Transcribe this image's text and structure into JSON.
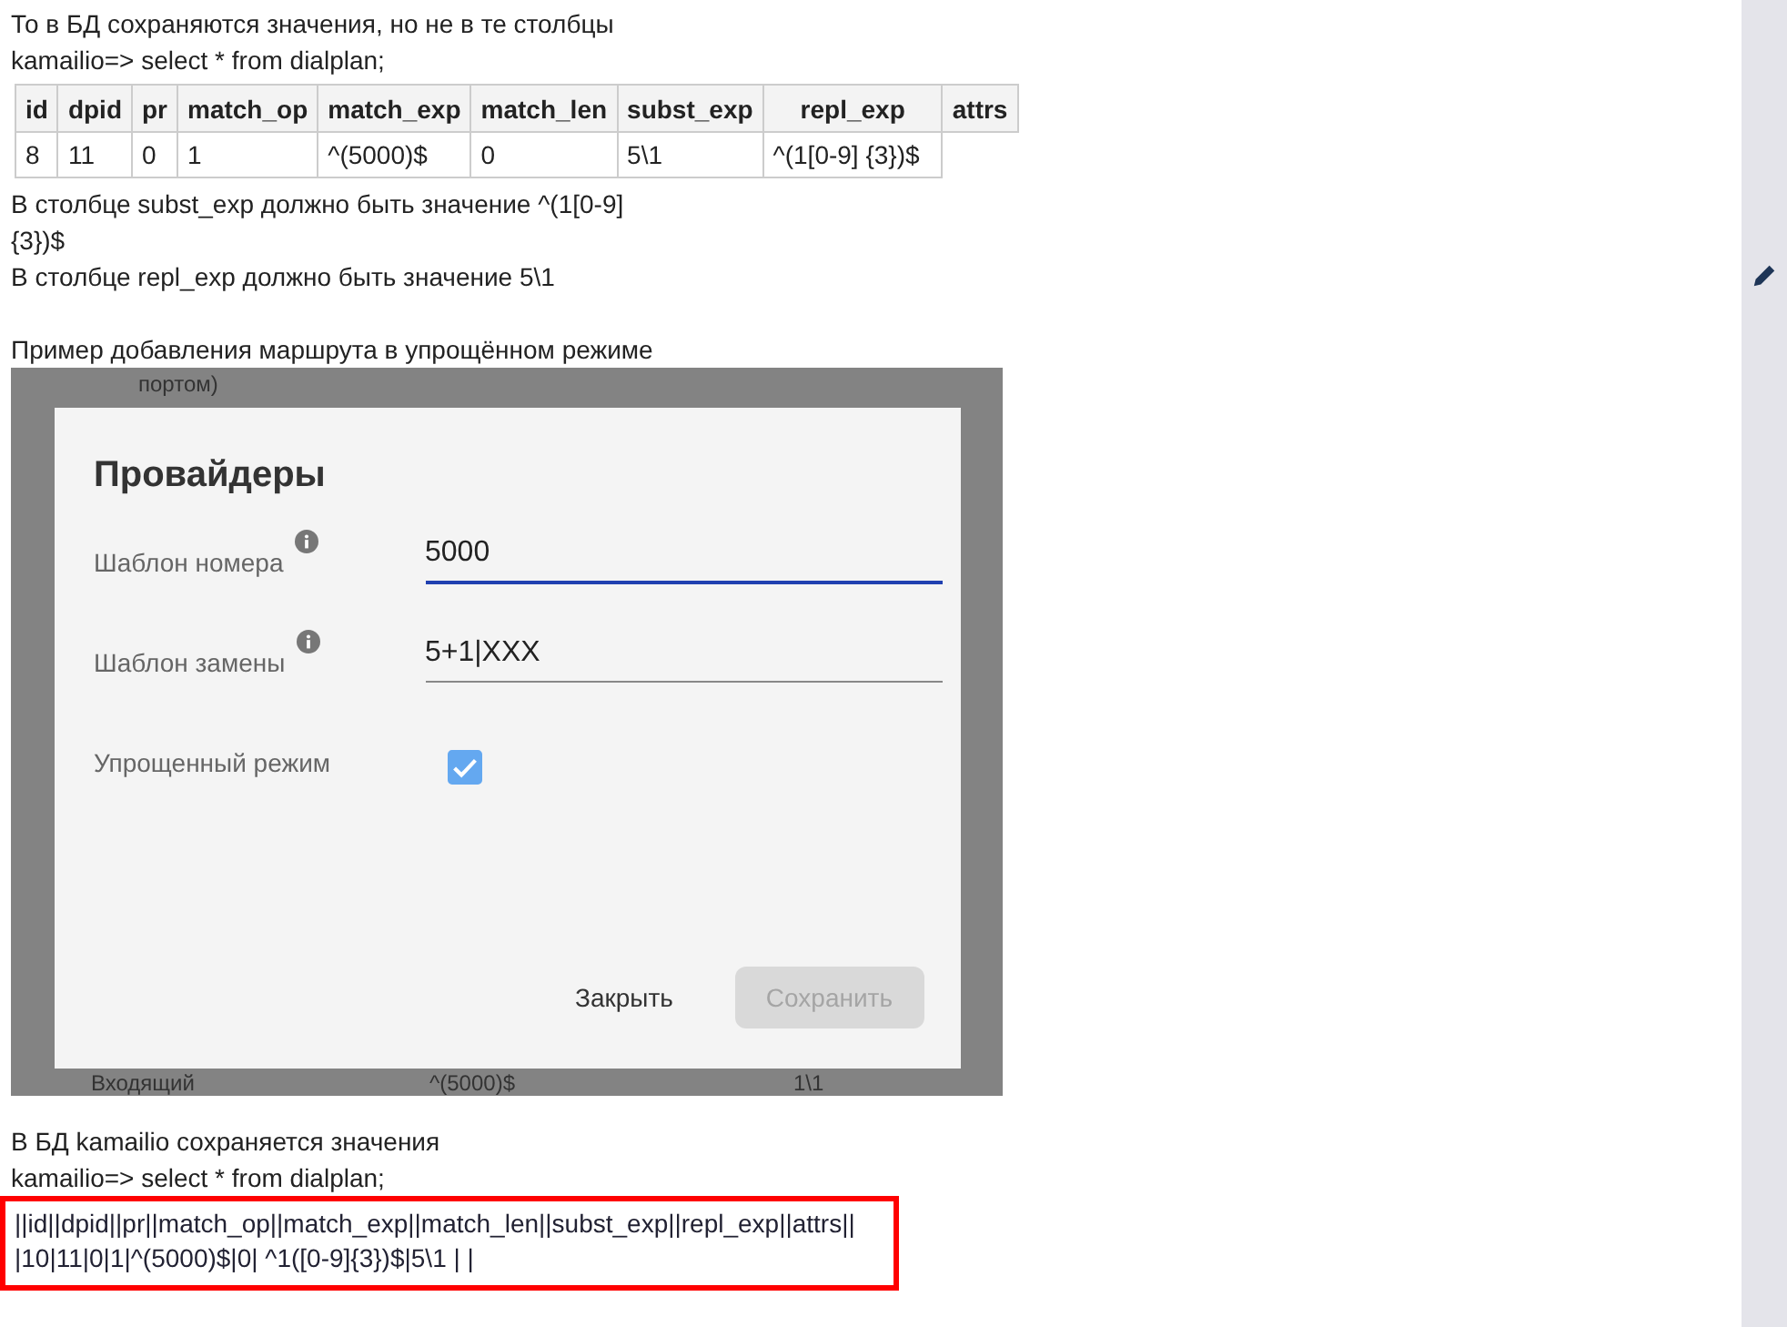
{
  "intro_lines": [
    "То в БД сохраняются значения, но не в те столбцы",
    "kamailio=> select * from dialplan;"
  ],
  "table": {
    "columns": [
      "id",
      "dpid",
      "pr",
      "match_op",
      "match_exp",
      "match_len",
      "subst_exp",
      "repl_exp",
      "attrs"
    ],
    "rows": [
      {
        "cells": [
          "8",
          "11",
          "0",
          "1",
          "^(5000)$",
          "0",
          "5\\1",
          "^(1[0-9] {3})$"
        ]
      }
    ]
  },
  "notes": [
    "В столбце subst_exp должно быть значение ^(1[0-9]",
    "{3})$",
    "В столбце repl_exp должно быть значение 5\\1"
  ],
  "example_caption": "Пример добавления маршрута в упрощённом режиме",
  "screenshot": {
    "background_texts": [
      "портом)"
    ],
    "background_row": [
      "Входящий",
      "^(5000)$",
      "1\\1"
    ],
    "dialog": {
      "title": "Провайдеры",
      "fields": [
        {
          "kind": "text",
          "label": "Шаблон номера",
          "value": "5000",
          "focused": true,
          "info": true
        },
        {
          "kind": "text",
          "label": "Шаблон замены",
          "value": "5+1|XXX",
          "focused": false,
          "info": true
        },
        {
          "kind": "checkbox",
          "label": "Упрощенный режим",
          "checked": true,
          "info": false
        }
      ],
      "buttons": [
        {
          "label": "Закрыть",
          "disabled": false
        },
        {
          "label": "Сохранить",
          "disabled": true
        }
      ]
    }
  },
  "outro_lines": [
    "В БД kamailio сохраняется значения",
    "kamailio=> select * from dialplan;"
  ],
  "highlighted_lines": [
    "||id||dpid||pr||match_op||match_exp||match_len||subst_exp||repl_exp||attrs||",
    "|10|11|0|1|^(5000)$|0| ^1([0-9]{3})$|5\\1 | |"
  ]
}
